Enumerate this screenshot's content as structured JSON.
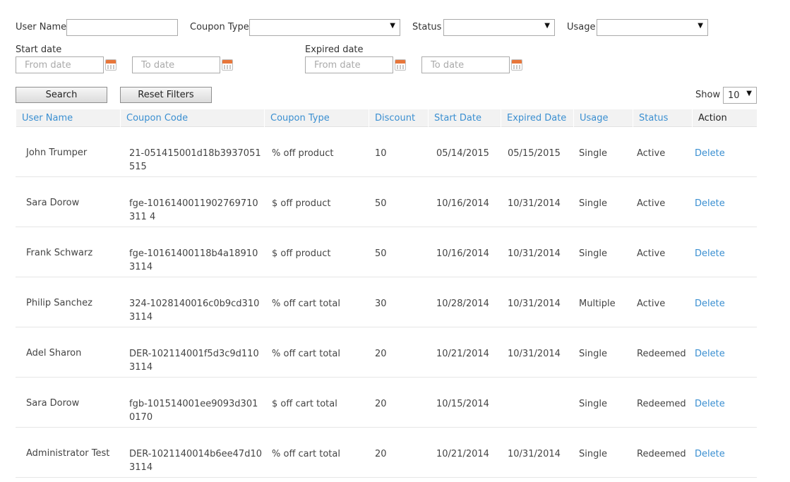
{
  "filters": {
    "user_name_label": "User Name",
    "user_name_value": "",
    "coupon_type_label": "Coupon Type",
    "coupon_type_value": "",
    "status_label": "Status",
    "status_value": "",
    "usage_label": "Usage",
    "usage_value": "",
    "start_date_label": "Start date",
    "expired_date_label": "Expired date",
    "from_placeholder": "From date",
    "to_placeholder": "To date",
    "search_label": "Search",
    "reset_label": "Reset Filters",
    "show_label": "Show",
    "show_value": "10",
    "dropdown_arrow": "▼"
  },
  "table": {
    "headers": [
      "User Name",
      "Coupon Code",
      "Coupon Type",
      "Discount",
      "Start Date",
      "Expired Date",
      "Usage",
      "Status",
      "Action"
    ],
    "rows": [
      {
        "user": "John Trumper",
        "code": "21-051415001d18b3937051515",
        "type": "% off product",
        "discount": "10",
        "start": "05/14/2015",
        "expired": "05/15/2015",
        "usage": "Single",
        "status": "Active",
        "action": "Delete"
      },
      {
        "user": "Sara Dorow",
        "code": "fge-1016140011902769710311 4",
        "type": "$ off product",
        "discount": "50",
        "start": "10/16/2014",
        "expired": "10/31/2014",
        "usage": "Single",
        "status": "Active",
        "action": "Delete"
      },
      {
        "user": "Frank Schwarz",
        "code": "fge-10161400118b4a189103114",
        "type": "$ off product",
        "discount": "50",
        "start": "10/16/2014",
        "expired": "10/31/2014",
        "usage": "Single",
        "status": "Active",
        "action": "Delete"
      },
      {
        "user": "Philip Sanchez",
        "code": "324-1028140016c0b9cd3103114",
        "type": "% off cart total",
        "discount": "30",
        "start": "10/28/2014",
        "expired": "10/31/2014",
        "usage": "Multiple",
        "status": "Active",
        "action": "Delete"
      },
      {
        "user": "Adel Sharon",
        "code": "DER-102114001f5d3c9d1103114",
        "type": "% off cart total",
        "discount": "20",
        "start": "10/21/2014",
        "expired": "10/31/2014",
        "usage": "Single",
        "status": "Redeemed",
        "action": "Delete"
      },
      {
        "user": "Sara Dorow",
        "code": "fgb-101514001ee9093d3010170",
        "type": "$ off cart total",
        "discount": "20",
        "start": "10/15/2014",
        "expired": "",
        "usage": "Single",
        "status": "Redeemed",
        "action": "Delete"
      },
      {
        "user": "Administrator Test",
        "code": "DER-1021140014b6ee47d103114",
        "type": "% off cart total",
        "discount": "20",
        "start": "10/21/2014",
        "expired": "10/31/2014",
        "usage": "Single",
        "status": "Redeemed",
        "action": "Delete"
      }
    ]
  },
  "colors": {
    "link": "#3a8fd1",
    "header_bg": "#f2f2f2",
    "calendar_accent": "#e8763a"
  },
  "icons": {
    "calendar": "calendar-icon",
    "dropdown": "chevron-down-icon"
  }
}
